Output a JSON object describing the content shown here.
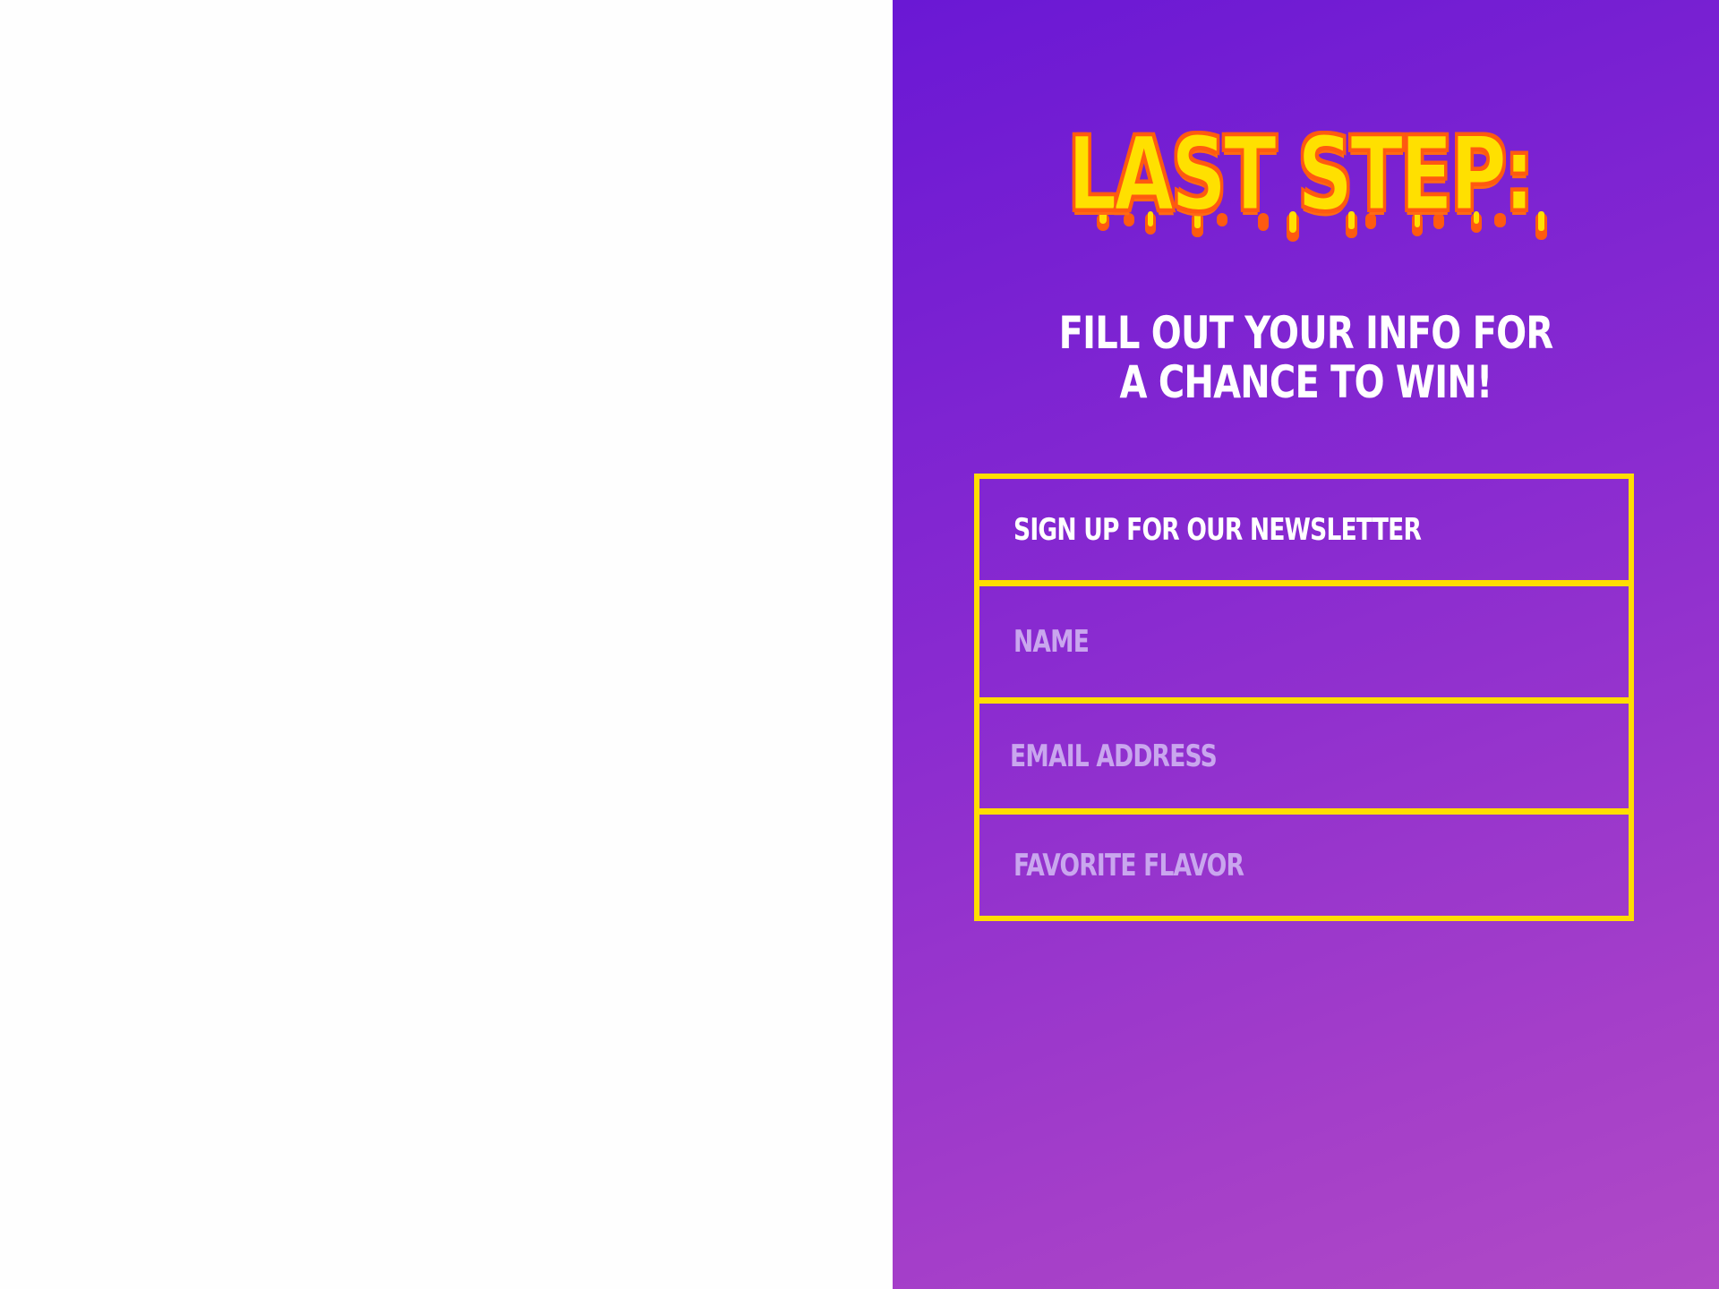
{
  "headline": "LAST STEP:",
  "subhead": {
    "line1": "FILL OUT YOUR INFO FOR",
    "line2": "A CHANCE TO WIN!"
  },
  "form": {
    "title": "SIGN UP FOR OUR NEWSLETTER",
    "fields": {
      "name": {
        "placeholder": "NAME",
        "value": ""
      },
      "email": {
        "placeholder": "EMAIL ADDRESS",
        "value": ""
      },
      "flavor": {
        "placeholder": "FAVORITE FLAVOR",
        "value": ""
      }
    }
  },
  "colors": {
    "gradient_start": "#6a18d4",
    "gradient_end": "#b04ac6",
    "headline_fill": "#ffe000",
    "headline_outline": "#ff5a10",
    "form_border": "#ffdd00",
    "placeholder": "#c9a6ee",
    "left_panel": "#fefefe"
  }
}
